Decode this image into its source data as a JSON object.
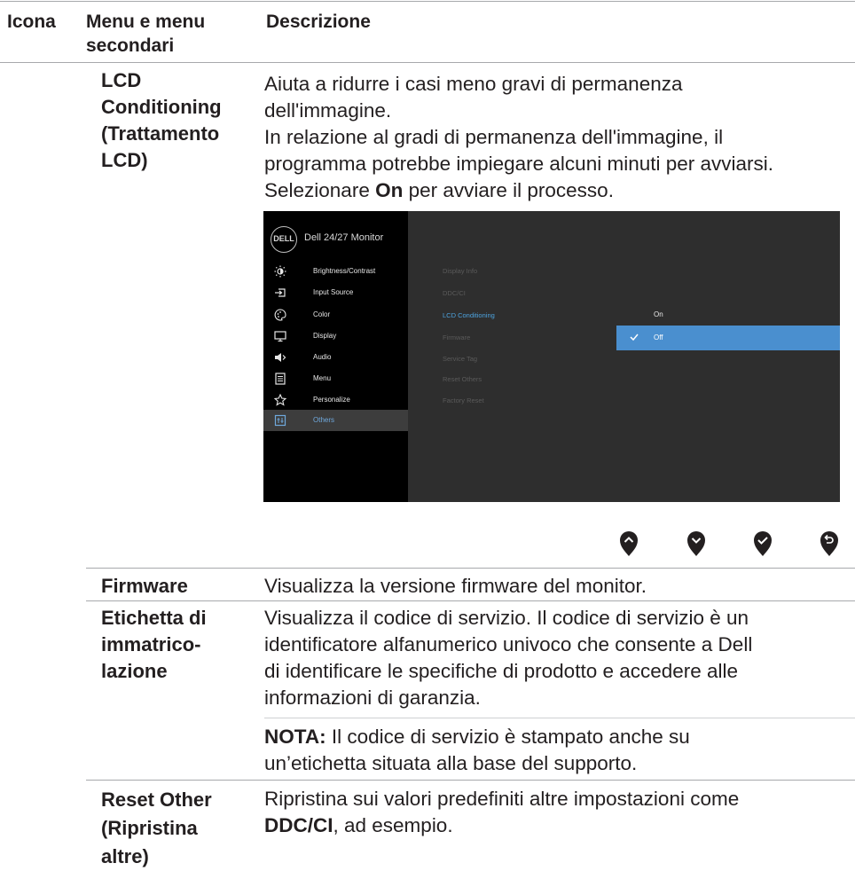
{
  "table": {
    "headers": {
      "icon": "Icona",
      "menu": "Menu e menu secondari",
      "desc": "Descrizione"
    }
  },
  "lcd": {
    "name_lines": [
      "LCD",
      "Conditioning",
      "(Trattamento",
      "LCD)"
    ],
    "desc_lines": [
      "Aiuta a ridurre i casi meno gravi di permanenza",
      "dell'immagine.",
      "In relazione al gradi di permanenza dell'immagine, il",
      "programma potrebbe impiegare alcuni minuti per avviarsi."
    ],
    "select_pre": "Selezionare ",
    "select_bold": "On",
    "select_post": " per avviare il processo."
  },
  "osd": {
    "logo": "DELL",
    "title": "Dell 24/27 Monitor",
    "menu": [
      {
        "label": "Brightness/Contrast",
        "icon": "brightness-icon"
      },
      {
        "label": "Input Source",
        "icon": "input-source-icon"
      },
      {
        "label": "Color",
        "icon": "color-icon"
      },
      {
        "label": "Display",
        "icon": "display-icon"
      },
      {
        "label": "Audio",
        "icon": "audio-icon"
      },
      {
        "label": "Menu",
        "icon": "menu-icon"
      },
      {
        "label": "Personalize",
        "icon": "star-icon"
      },
      {
        "label": "Others",
        "icon": "others-icon"
      }
    ],
    "submenu": [
      "Display Info",
      "DDC/CI",
      "LCD Conditioning",
      "Firmware",
      "Service Tag",
      "Reset Others",
      "Factory Reset"
    ],
    "options": {
      "on": "On",
      "off": "Off"
    },
    "colors": {
      "accent": "#4a8fcf",
      "selected_text": "#4da3df"
    }
  },
  "joystick_icons": [
    "up-icon",
    "down-icon",
    "check-icon",
    "back-icon"
  ],
  "firmware": {
    "name": "Firmware",
    "desc": "Visualizza la versione firmware del monitor."
  },
  "service": {
    "name_lines": [
      "Etichetta di",
      "immatrico-",
      "lazione"
    ],
    "desc_lines": [
      "Visualizza il codice di servizio. Il codice di servizio è un",
      "identificatore alfanumerico univoco che consente a Dell",
      "di identificare le specifiche di prodotto e accedere alle",
      "informazioni di garanzia."
    ],
    "note_bold": "NOTA:",
    "note_lines": [
      " Il codice di servizio è stampato anche su",
      "un’etichetta situata alla base del supporto."
    ]
  },
  "reset": {
    "name_lines": [
      "Reset Other",
      "(Ripristina",
      "altre)"
    ],
    "desc_line1": "Ripristina sui valori predefiniti altre impostazioni come",
    "desc_bold": "DDC/CI",
    "desc_post": ", ad esempio."
  }
}
